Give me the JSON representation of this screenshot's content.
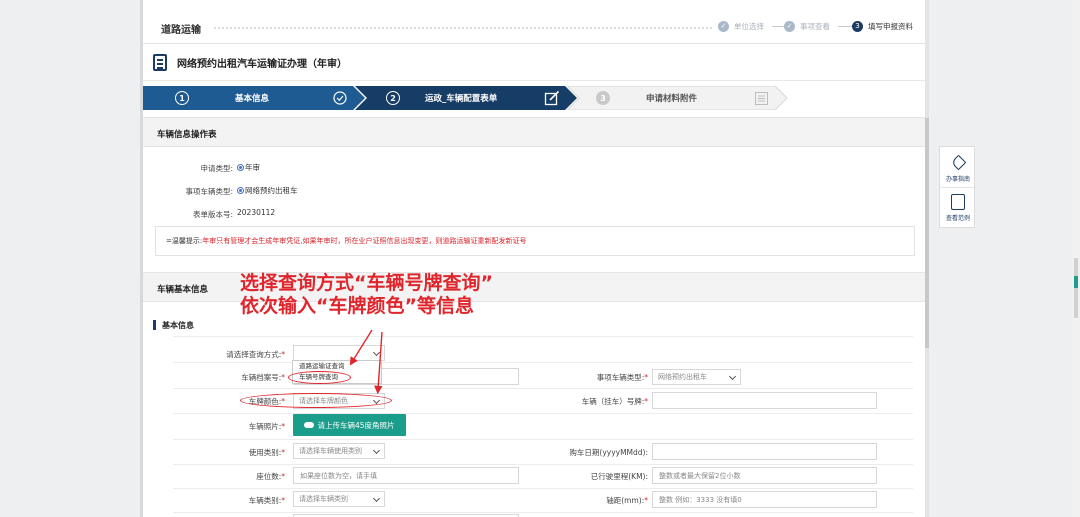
{
  "header": {
    "title": "道路运输",
    "steps": [
      {
        "num": "✓",
        "label": "单位选择"
      },
      {
        "num": "✓",
        "label": "事项查看"
      },
      {
        "num": "3",
        "label": "填写申报资料"
      }
    ]
  },
  "form_title": "网络预约出租汽车运输证办理（年审）",
  "stepbar": [
    {
      "num": "1",
      "label": "基本信息"
    },
    {
      "num": "2",
      "label": "运政_车辆配置表单"
    },
    {
      "num": "3",
      "label": "申请材料附件"
    }
  ],
  "op_section": {
    "title": "车辆信息操作表",
    "apply_type_label": "申请类型:",
    "apply_type_value": "年审",
    "vehicle_type_label": "事项车辆类型:",
    "vehicle_type_value": "网络预约出租车",
    "version_label": "表单版本号:",
    "version_value": "20230112",
    "notice_prefix": "=温馨提示:",
    "notice_text": "年审只有管理才会生成年审凭证,如果年审时，所在业户证照信息出现变更，则道路运输证重新配发新证号"
  },
  "basic_section": {
    "title": "车辆基本信息",
    "sub_title": "基本信息",
    "query_label": "请选择查询方式:",
    "query_options": [
      "道路运输证查询",
      "车辆号牌查询"
    ],
    "archive_label": "车辆档案号:",
    "item_vehicle_type_label": "事项车辆类型:",
    "item_vehicle_type_value": "网络预约出租车",
    "plate_color_label": "车牌颜色:",
    "plate_color_placeholder": "请选择车牌颜色",
    "plate_no_label": "车辆（挂车）号牌:",
    "photo_label": "车辆照片:",
    "upload_label": "请上传车辆45度角照片",
    "use_type_label": "使用类别:",
    "use_type_placeholder": "请选择车辆使用类别",
    "buy_date_label": "购车日期(yyyyMMdd):",
    "seats_label": "座位数:",
    "seats_placeholder": "如果座位数为空，请手填",
    "mileage_label": "已行驶里程(KM):",
    "mileage_placeholder": "整数或者最大保留2位小数",
    "category_label": "车辆类别:",
    "category_placeholder": "请选择车辆类别",
    "wheelbase_label": "轴距(mm):",
    "wheelbase_placeholder": "整数 例如：3333 没有填0"
  },
  "annotation": {
    "line1": "选择查询方式“车辆号牌查询”",
    "line2": "依次输入“车牌颜色”等信息"
  },
  "float_panel": {
    "guide_label": "办事指南",
    "sample_label": "查看范例"
  },
  "colors": {
    "navy": "#1d3c64",
    "accent_red": "#e0262d",
    "teal": "#1a9d8b",
    "step_active": "#1e5b93",
    "step_inactive": "#f0f0f0"
  }
}
